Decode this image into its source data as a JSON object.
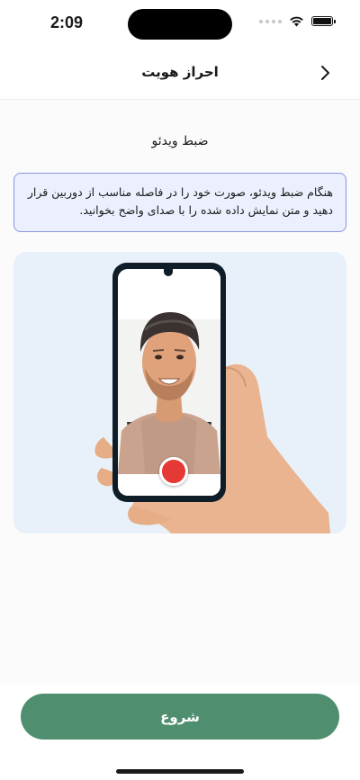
{
  "status_bar": {
    "time": "2:09",
    "icons": [
      "signal-dots-icon",
      "wifi-icon",
      "battery-icon"
    ]
  },
  "nav": {
    "title": "احراز هویت",
    "back_icon": "chevron-right-icon"
  },
  "main": {
    "section_title": "ضبط ویدئو",
    "info_text": "هنگام ضبط ویدئو، صورت خود را در فاصله مناسب از دوربین قرار دهید و متن نمایش داده شده را با صدای واضح بخوانید.",
    "illustration": {
      "description_icon": "hand-holding-phone-selfie-icon",
      "record_icon": "record-button-icon"
    }
  },
  "footer": {
    "start_label": "شروع"
  },
  "colors": {
    "primary_button": "#4f8f6f",
    "info_bg": "#eceffd",
    "info_border": "#8b95e3",
    "illustration_bg": "#e8f1f9",
    "record_red": "#e53935"
  }
}
